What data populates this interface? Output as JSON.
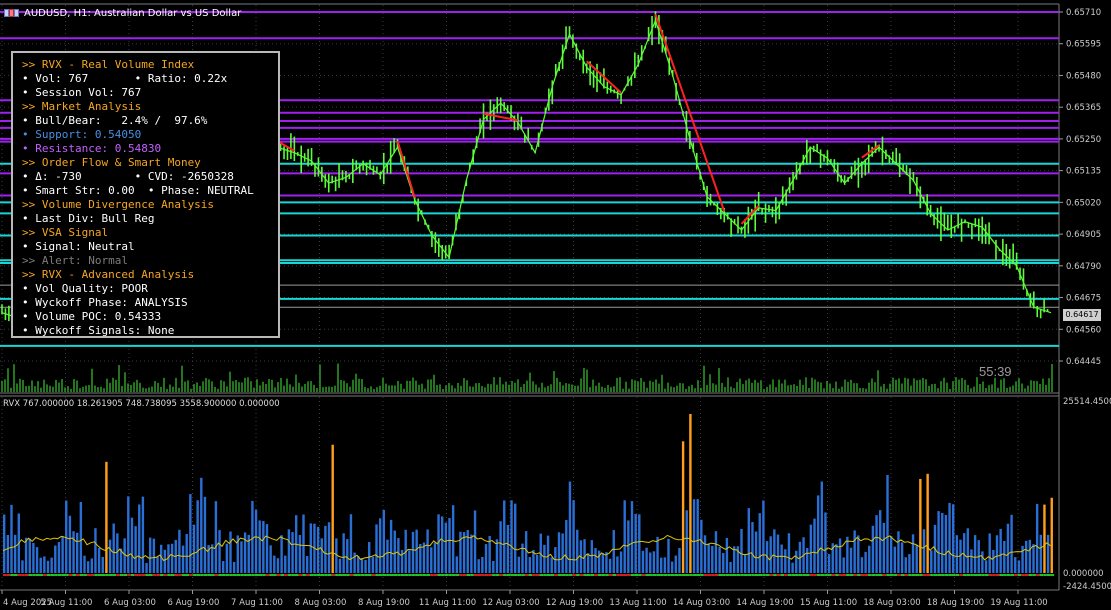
{
  "window": {
    "title": "AUDUSD, H1:  Australian Dollar vs US Dollar"
  },
  "info_panel": {
    "lines": [
      {
        "text": ">> RVX - Real Volume Index",
        "tone": "hdr"
      },
      {
        "text": "• Vol: 767       • Ratio: 0.22x",
        "tone": "wh"
      },
      {
        "text": "• Session Vol: 767",
        "tone": "wh"
      },
      {
        "text": ">> Market Analysis",
        "tone": "hdr"
      },
      {
        "text": "• Bull/Bear:   2.4% /  97.6%",
        "tone": "wh"
      },
      {
        "text": "• Support: 0.54050",
        "tone": "bl"
      },
      {
        "text": "• Resistance: 0.54830",
        "tone": "pu"
      },
      {
        "text": ">> Order Flow & Smart Money",
        "tone": "hdr"
      },
      {
        "text": "• Δ: -730        • CVD: -2650328",
        "tone": "wh"
      },
      {
        "text": "• Smart Str: 0.00  • Phase: NEUTRAL",
        "tone": "wh"
      },
      {
        "text": ">> Volume Divergence Analysis",
        "tone": "hdr"
      },
      {
        "text": "• Last Div: Bull Reg",
        "tone": "wh"
      },
      {
        "text": ">> VSA Signal",
        "tone": "hdr"
      },
      {
        "text": "• Signal: Neutral",
        "tone": "wh"
      },
      {
        "text": ">> Alert: Normal",
        "tone": "gr"
      },
      {
        "text": ">> RVX - Advanced Analysis",
        "tone": "hdr"
      },
      {
        "text": "• Vol Quality: POOR",
        "tone": "wh"
      },
      {
        "text": "• Wyckoff Phase: ANALYSIS",
        "tone": "wh"
      },
      {
        "text": "• Volume POC: 0.54333",
        "tone": "wh"
      },
      {
        "text": "• Wyckoff Signals: None",
        "tone": "wh"
      }
    ]
  },
  "price_axis": {
    "labels": [
      "0.65710",
      "0.65595",
      "0.65480",
      "0.65365",
      "0.65250",
      "0.65135",
      "0.65020",
      "0.64905",
      "0.64790",
      "0.64675",
      "0.64560",
      "0.64445"
    ],
    "current_price": "0.64617"
  },
  "timer": "55:39",
  "indicator": {
    "title": "RVX 767.000000 18.261905 748.738095 3558.900000 0.000000",
    "axis_labels": [
      "25514.4500",
      "0.000000",
      "-2424.4500"
    ]
  },
  "time_axis": {
    "labels": [
      "4 Aug 2025",
      "5 Aug 11:00",
      "6 Aug 03:00",
      "6 Aug 19:00",
      "7 Aug 11:00",
      "8 Aug 03:00",
      "8 Aug 19:00",
      "11 Aug 11:00",
      "12 Aug 03:00",
      "12 Aug 19:00",
      "13 Aug 11:00",
      "14 Aug 03:00",
      "14 Aug 19:00",
      "15 Aug 11:00",
      "18 Aug 03:00",
      "18 Aug 19:00",
      "19 Aug 11:00"
    ]
  },
  "chart_data": {
    "type": "line",
    "title": "AUDUSD, H1:  Australian Dollar vs US Dollar",
    "xlabel": "",
    "ylabel": "",
    "ylim": [
      0.64415,
      0.65725
    ],
    "x_ticks": [
      "4 Aug 2025",
      "5 Aug 11:00",
      "6 Aug 03:00",
      "6 Aug 19:00",
      "7 Aug 11:00",
      "8 Aug 03:00",
      "8 Aug 19:00",
      "11 Aug 11:00",
      "12 Aug 03:00",
      "12 Aug 19:00",
      "13 Aug 11:00",
      "14 Aug 03:00",
      "14 Aug 19:00",
      "15 Aug 11:00",
      "18 Aug 03:00",
      "18 Aug 19:00",
      "19 Aug 11:00"
    ],
    "y_ticks": [
      0.6571,
      0.65595,
      0.6548,
      0.65365,
      0.6525,
      0.65135,
      0.6502,
      0.64905,
      0.6479,
      0.64675,
      0.6456,
      0.64445
    ],
    "series": [
      {
        "values": [
          0.6462,
          0.646,
          0.6466,
          0.6471,
          0.6482,
          0.6493,
          0.6489,
          0.6497,
          0.6503,
          0.651,
          0.6516,
          0.6522,
          0.6525,
          0.652,
          0.6528,
          0.6531,
          0.6522,
          0.652,
          0.6517,
          0.6509,
          0.6511,
          0.6516,
          0.6512,
          0.6522,
          0.6503,
          0.649,
          0.6482,
          0.651,
          0.6532,
          0.6538,
          0.6531,
          0.652,
          0.6544,
          0.6563,
          0.6551,
          0.6544,
          0.6541,
          0.6552,
          0.6568,
          0.6548,
          0.6525,
          0.6504,
          0.6498,
          0.6492,
          0.65,
          0.6499,
          0.651,
          0.6522,
          0.6518,
          0.6509,
          0.6516,
          0.6522,
          0.6516,
          0.651,
          0.6498,
          0.6492,
          0.6495,
          0.6493,
          0.6485,
          0.6479,
          0.6464,
          0.6462
        ]
      }
    ],
    "reference_lines": {
      "magenta": [
        0.6571,
        0.65615,
        0.6539,
        0.65345,
        0.65315,
        0.6529,
        0.6525,
        0.6524,
        0.65125,
        0.65045
      ],
      "cyan": [
        0.6516,
        0.6502,
        0.6498,
        0.649,
        0.6481,
        0.648,
        0.6467,
        0.645
      ],
      "gray": [
        0.6472,
        0.6464
      ]
    },
    "current_price": 0.64617
  },
  "colors": {
    "background": "#000000",
    "grid": "#3a3a3a",
    "candles": "#5dfc3a",
    "bearish_wedge": "#ff2020",
    "resistance_line": "#a020f0",
    "support_line": "#18d6d6",
    "volume_bar": "#2a6fd6",
    "spike_bar": "#ff9f1c",
    "signal_line": "#e1c30a",
    "axis_text": "#cccccc"
  }
}
